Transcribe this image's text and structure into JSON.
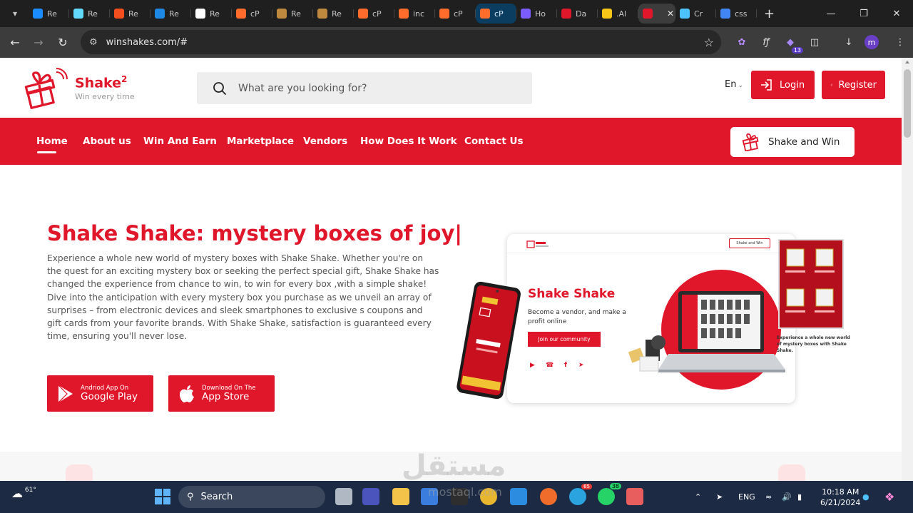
{
  "browser": {
    "tabs": [
      {
        "label": "Re",
        "icon": "cube-icon",
        "color": "#1a8cff"
      },
      {
        "label": "Re",
        "icon": "react-icon",
        "color": "#61dafb"
      },
      {
        "label": "Re",
        "icon": "figma-icon",
        "color": "#f24e1e"
      },
      {
        "label": "Re",
        "icon": "mui-icon",
        "color": "#1e88e5"
      },
      {
        "label": "Re",
        "icon": "chatgpt-icon",
        "color": "#ffffff"
      },
      {
        "label": "cP",
        "icon": "cpanel-icon",
        "color": "#ff6c2c"
      },
      {
        "label": "Re",
        "icon": "chef-icon",
        "color": "#c08a3e"
      },
      {
        "label": "Re",
        "icon": "chef-icon",
        "color": "#c08a3e"
      },
      {
        "label": "cP",
        "icon": "cpanel-icon",
        "color": "#ff6c2c"
      },
      {
        "label": "inc",
        "icon": "cpanel-icon",
        "color": "#ff6c2c"
      },
      {
        "label": "cP",
        "icon": "cpanel-icon",
        "color": "#ff6c2c"
      },
      {
        "label": "cP",
        "icon": "cpanel-icon",
        "color": "#ff6c2c"
      },
      {
        "label": "Ho",
        "icon": "h-icon",
        "color": "#7b5cff"
      },
      {
        "label": "Da",
        "icon": "shake-icon",
        "color": "#e0162b"
      },
      {
        "label": ".Al",
        "icon": "five-icon",
        "color": "#f5c518"
      },
      {
        "label": "",
        "icon": "shake-icon",
        "color": "#e0162b"
      },
      {
        "label": "Cr",
        "icon": "globe-icon",
        "color": "#4cc2ff"
      },
      {
        "label": "css",
        "icon": "google-icon",
        "color": "#4285f4"
      }
    ],
    "url": "winshakes.com/#",
    "extension_badge": "13",
    "profile_initial": "m"
  },
  "header": {
    "logo_name": "Shake",
    "logo_sup": "2",
    "logo_tagline": "Win every time",
    "search_placeholder": "What are you looking for?",
    "language": "En",
    "login_label": "Login",
    "register_label": "Register"
  },
  "nav": {
    "items": [
      "Home",
      "About us",
      "Win And Earn",
      "Marketplace",
      "Vendors",
      "How Does It Work",
      "Contact Us"
    ],
    "cta_label": "Shake and Win"
  },
  "hero": {
    "title": "Shake Shake: mystery boxes of joy|",
    "description": "Experience a whole new world of mystery boxes with Shake Shake. Whether you're on the quest for an exciting mystery box or seeking the perfect special gift, Shake Shake has changed the experience from chance to win, to win for every box ,with a simple shake! Dive into the anticipation with every mystery box you purchase as we unveil an array of surprises – from electronic devices and sleek smartphones to exclusive s coupons and gift cards from your favorite brands. With Shake Shake, satisfaction is guaranteed every time, ensuring you'll never lose.",
    "google_small": "Andriod App On",
    "google_big": "Google Play",
    "apple_small": "Download On The",
    "apple_big": "App Store"
  },
  "mockup": {
    "title": "Shake Shake",
    "subtitle": "Become a vendor, and make a profit online",
    "join_label": "Join our community",
    "header_button": "Shake and Win",
    "caption": "Experience a whole new world of mystery boxes with Shake Shake."
  },
  "taskbar": {
    "temperature": "61°",
    "search_label": "Search",
    "telegram_badge": "65",
    "whatsapp_badge": "38",
    "language": "ENG",
    "time": "10:18 AM",
    "date": "6/21/2024"
  },
  "watermark": {
    "text": "مستقل",
    "sub": "mostaql.com"
  },
  "colors": {
    "brand_red": "#e0162b",
    "chrome_dark": "#1f1f1f",
    "taskbar": "#1c2a44"
  }
}
